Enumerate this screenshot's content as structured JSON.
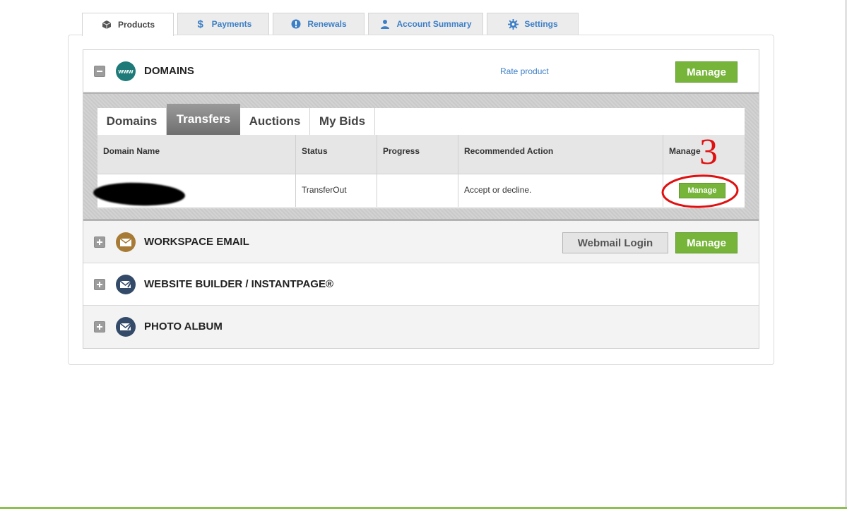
{
  "top_tabs": [
    {
      "label": "Products",
      "icon": "box-icon"
    },
    {
      "label": "Payments",
      "icon": "dollar-icon"
    },
    {
      "label": "Renewals",
      "icon": "alert-icon"
    },
    {
      "label": "Account Summary",
      "icon": "user-icon"
    },
    {
      "label": "Settings",
      "icon": "gear-icon"
    }
  ],
  "active_top_tab": "Products",
  "domains": {
    "title": "DOMAINS",
    "icon_text": "www",
    "rate_link": "Rate product",
    "manage_label": "Manage",
    "sub_tabs": [
      "Domains",
      "Transfers",
      "Auctions",
      "My Bids"
    ],
    "active_sub_tab": "Transfers",
    "table": {
      "headers": [
        "Domain Name",
        "Status",
        "Progress",
        "Recommended Action",
        "Manage"
      ],
      "rows": [
        {
          "domain": "",
          "status": "TransferOut",
          "progress": "",
          "action": "Accept or decline.",
          "manage_label": "Manage"
        }
      ]
    }
  },
  "workspace_email": {
    "title": "WORKSPACE EMAIL",
    "webmail_label": "Webmail Login",
    "manage_label": "Manage"
  },
  "website_builder": {
    "title": "WEBSITE BUILDER / INSTANTPAGE®"
  },
  "photo_album": {
    "title": "PHOTO ALBUM"
  },
  "annotation": {
    "text": "3",
    "color": "#e01010"
  },
  "colors": {
    "accent_green": "#76b539",
    "link_blue": "#3d7fc6",
    "domains_icon": "#1d7a78",
    "email_icon": "#a77b35",
    "builder_icon": "#334a69"
  }
}
